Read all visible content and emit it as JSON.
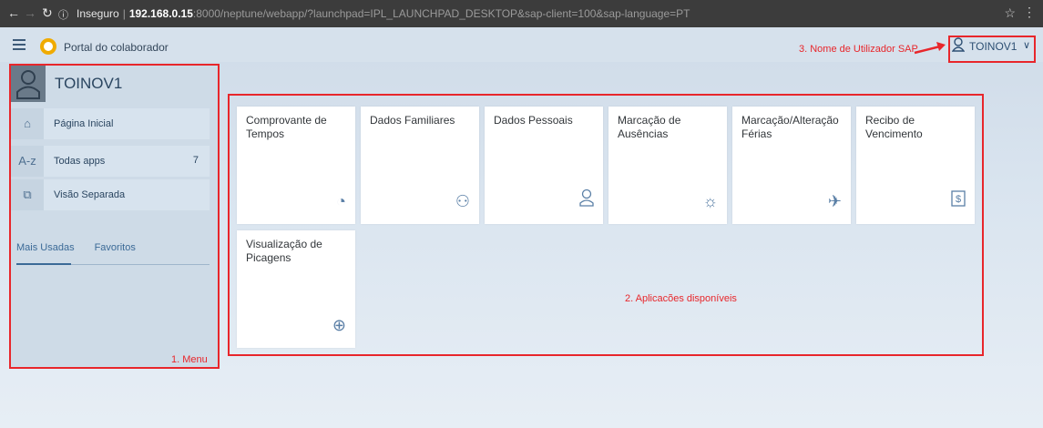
{
  "browser": {
    "insecure_label": "Inseguro",
    "url_host": "192.168.0.15",
    "url_path": ":8000/neptune/webapp/?launchpad=IPL_LAUNCHPAD_DESKTOP&sap-client=100&sap-language=PT"
  },
  "header": {
    "portal_title": "Portal do colaborador",
    "user_name": "TOINOV1"
  },
  "annotations": {
    "user_note": "3. Nome de Utilizador SAP",
    "apps_note": "2. Aplicacões disponíveis",
    "menu_note": "1. Menu"
  },
  "sidebar": {
    "user_name": "TOINOV1",
    "items": [
      {
        "icon": "home-icon",
        "label": "Página Inicial",
        "count": ""
      },
      {
        "icon": "az-icon",
        "label": "Todas apps",
        "count": "7"
      },
      {
        "icon": "split-view-icon",
        "label": "Visão Separada",
        "count": ""
      }
    ],
    "tabs": [
      "Mais Usadas",
      "Favoritos"
    ]
  },
  "tiles": [
    {
      "title": "Comprovante de Tempos",
      "icon": "clock-document-icon"
    },
    {
      "title": "Dados Familiares",
      "icon": "family-icon"
    },
    {
      "title": "Dados Pessoais",
      "icon": "person-icon"
    },
    {
      "title": "Marcação de Ausências",
      "icon": "sun-icon"
    },
    {
      "title": "Marcação/Alteração Férias",
      "icon": "airplane-icon"
    },
    {
      "title": "Recibo de Vencimento",
      "icon": "dollar-document-icon"
    },
    {
      "title": "Visualização de Picagens",
      "icon": "time-entry-icon"
    }
  ],
  "colors": {
    "accent": "#3b6a97",
    "annotation": "#e8262b",
    "logo": "#f0ab00"
  }
}
